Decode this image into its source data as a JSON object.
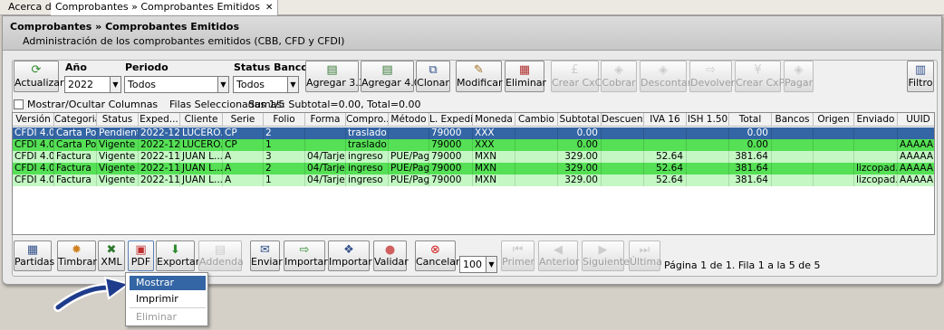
{
  "tabs": [
    {
      "label": "Acerca de"
    },
    {
      "label": "Comprobantes » Comprobantes Emitidos",
      "close": "✕"
    }
  ],
  "header": {
    "title": "Comprobantes » Comprobantes Emitidos",
    "subtitle": "Administración de los comprobantes emitidos (CBB, CFD y CFDI)"
  },
  "toolbar": {
    "actualizar": "Actualizar",
    "anio_label": "Año",
    "anio_value": "2022",
    "periodo_label": "Periodo",
    "periodo_value": "Todos",
    "status_label": "Status Banco",
    "status_value": "Todos",
    "agregar33": "Agregar 3.3",
    "agregar40": "Agregar 4.0",
    "clonar": "Clonar",
    "modificar": "Modificar",
    "eliminar": "Eliminar",
    "crear_cxc": "Crear CxC",
    "cobrar": "Cobrar",
    "descontar": "Descontar",
    "devolver": "Devolver",
    "crear_cxp": "Crear CxP",
    "pagar": "Pagar",
    "filtro": "Filtro"
  },
  "info": {
    "mostrar_columnas": "Mostrar/Ocultar Columnas",
    "filas": "Filas Seleccionadas  1/5",
    "sumas": "Sumas:  Subtotal=0.00, Total=0.00"
  },
  "grid": {
    "headers": [
      "Versión",
      "Categoria",
      "Status",
      "Exped...",
      "Cliente",
      "Serie",
      "Folio",
      "Forma",
      "Compro...",
      "Método",
      "L. Expedi...",
      "Moneda",
      "Cambio",
      "Subtotal",
      "Descuento",
      "IVA 16",
      "ISH 1.50",
      "Total",
      "Bancos",
      "Origen",
      "Enviado",
      "UUID"
    ],
    "rows": [
      {
        "cells": [
          "CFDI 4.0",
          "Carta Po...",
          "Pendiente",
          "2022-12-...",
          "LUCERO...",
          "CP",
          "2",
          "",
          "traslado",
          "",
          "79000",
          "XXX",
          "",
          "0.00",
          "",
          "",
          "",
          "0.00",
          "",
          "",
          "",
          ""
        ]
      },
      {
        "cells": [
          "CFDI 4.0",
          "Carta Po...",
          "Vigente",
          "2022-12-...",
          "LUCERO...",
          "CP",
          "1",
          "",
          "traslado",
          "",
          "79000",
          "XXX",
          "",
          "0.00",
          "",
          "",
          "",
          "0.00",
          "",
          "",
          "",
          "AAAAA..."
        ]
      },
      {
        "cells": [
          "CFDI 4.0",
          "Factura",
          "Vigente",
          "2022-11-...",
          "JUAN L...",
          "A",
          "3",
          "04/Tarjet...",
          "ingreso",
          "PUE/Pag...",
          "79000",
          "MXN",
          "",
          "329.00",
          "",
          "52.64",
          "",
          "381.64",
          "",
          "",
          "",
          "AAAAA..."
        ]
      },
      {
        "cells": [
          "CFDI 4.0",
          "Factura",
          "Vigente",
          "2022-11-...",
          "JUAN L...",
          "A",
          "2",
          "04/Tarjet...",
          "ingreso",
          "PUE/Pag...",
          "79000",
          "MXN",
          "",
          "329.00",
          "",
          "52.64",
          "",
          "381.64",
          "",
          "",
          "lizcopad...",
          "AAAAA..."
        ]
      },
      {
        "cells": [
          "CFDI 4.0",
          "Factura",
          "Vigente",
          "2022-11-...",
          "JUAN L...",
          "A",
          "1",
          "04/Tarjet...",
          "ingreso",
          "PUE/Pag...",
          "79000",
          "MXN",
          "",
          "329.00",
          "",
          "52.64",
          "",
          "381.64",
          "",
          "",
          "lizcopad...",
          "AAAAA..."
        ]
      }
    ]
  },
  "bottom": {
    "partidas": "Partidas",
    "timbrar": "Timbrar",
    "xml": "XML",
    "pdf": "PDF",
    "exportar": "Exportar",
    "addenda": "Addenda",
    "enviar": "Enviar",
    "importar1": "Importar",
    "importar2": "Importar",
    "validar": "Validar",
    "cancelar": "Cancelar",
    "pagesize": "100",
    "primer": "Primer",
    "anterior": "Anterior",
    "siguiente": "Siguiente",
    "ultima": "Última",
    "pagina": "Página 1 de 1. Fila 1 a la 5 de 5"
  },
  "menu": {
    "mostrar": "Mostrar",
    "imprimir": "Imprimir",
    "eliminar": "Eliminar"
  },
  "colors": {
    "selected": "#3465a4",
    "green": "#55e055",
    "light_green": "#c4f7c4"
  }
}
